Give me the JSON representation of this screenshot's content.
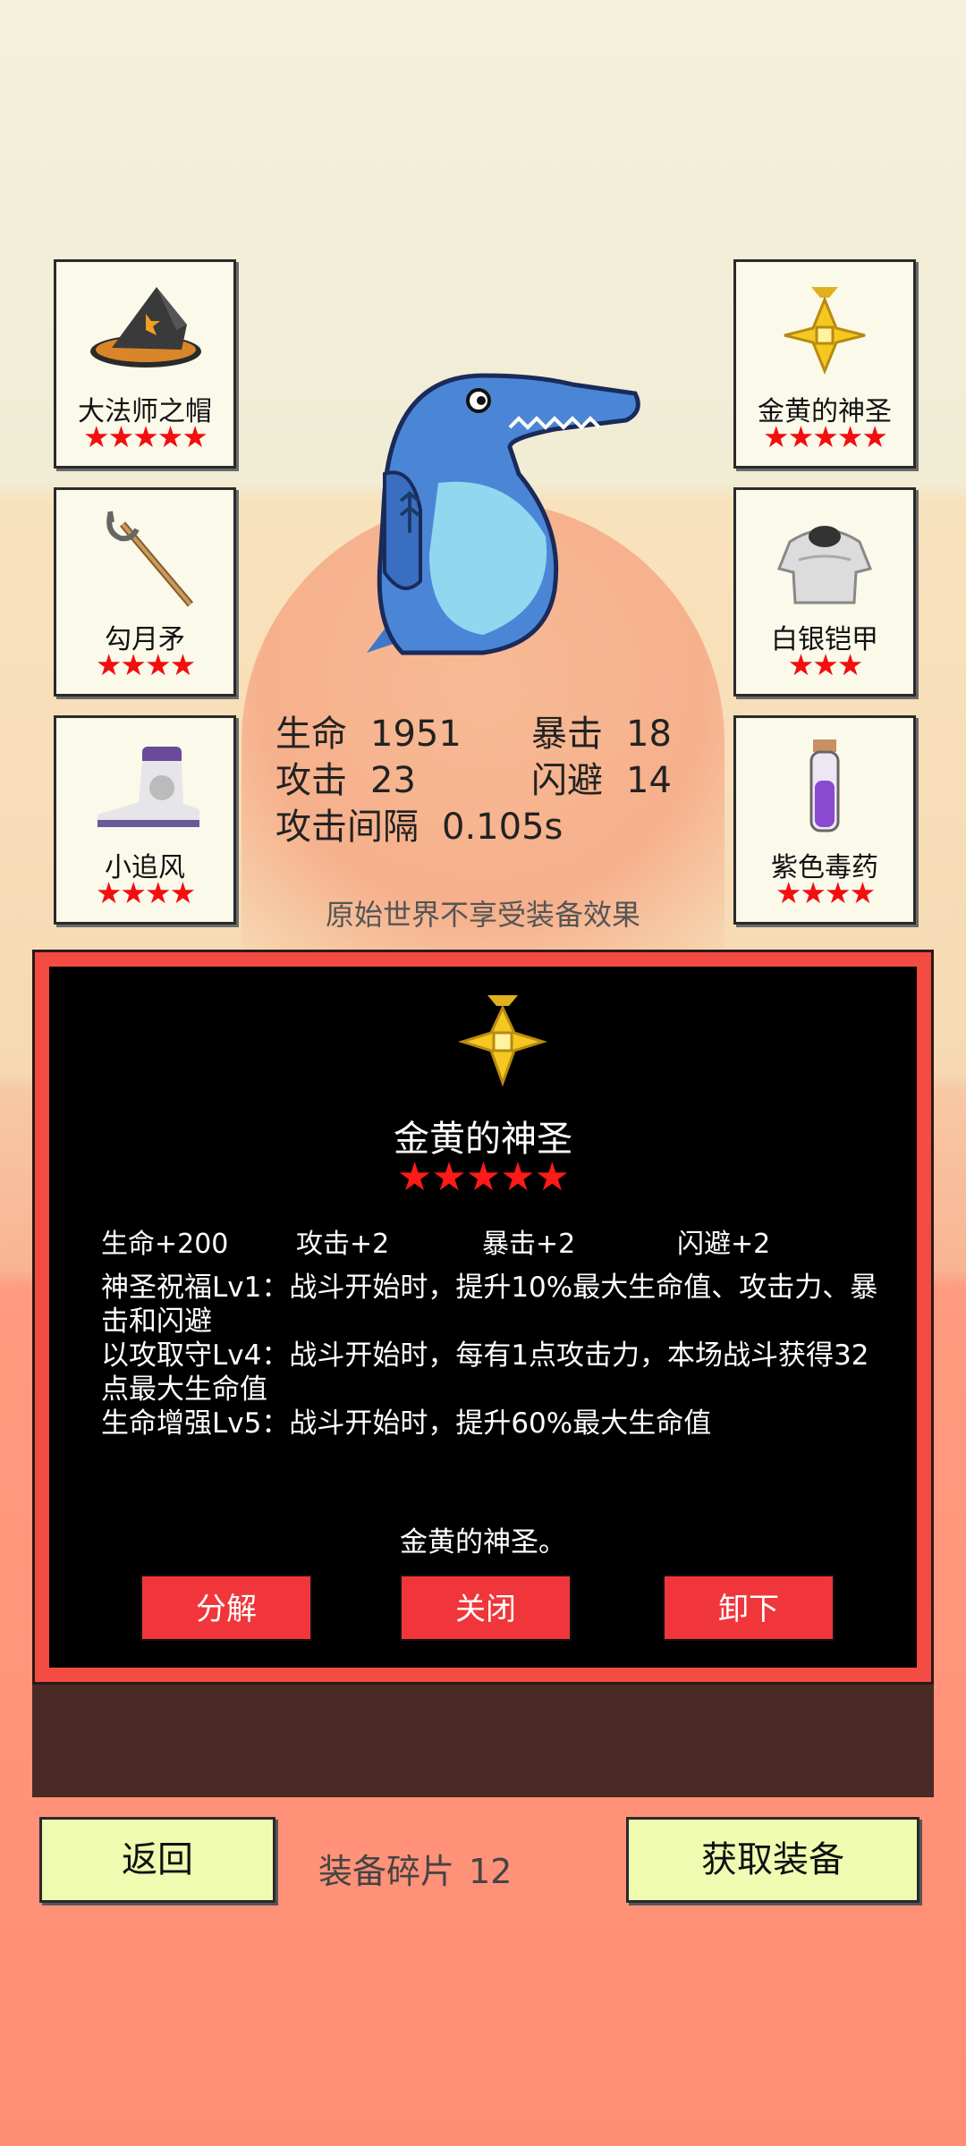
{
  "equipment_left": [
    {
      "name": "大法师之帽",
      "stars": "★★★★★",
      "icon": "wizard-hat-icon"
    },
    {
      "name": "勾月矛",
      "stars": "★★★★",
      "icon": "trident-icon"
    },
    {
      "name": "小追风",
      "stars": "★★★★",
      "icon": "boot-icon"
    }
  ],
  "equipment_right": [
    {
      "name": "金黄的神圣",
      "stars": "★★★★★",
      "icon": "gold-holy-cross-icon"
    },
    {
      "name": "白银铠甲",
      "stars": "★★★",
      "icon": "silver-armor-icon"
    },
    {
      "name": "紫色毒药",
      "stars": "★★★★",
      "icon": "purple-potion-icon"
    }
  ],
  "character": {
    "icon": "blue-crocodile-icon"
  },
  "stats": {
    "hp_label": "生命",
    "hp_value": "1951",
    "crit_label": "暴击",
    "crit_value": "18",
    "atk_label": "攻击",
    "atk_value": "23",
    "dodge_label": "闪避",
    "dodge_value": "14",
    "interval_label": "攻击间隔",
    "interval_value": "0.105s"
  },
  "note": "原始世界不享受装备效果",
  "detail": {
    "title": "金黄的神圣",
    "stars": "★★★★★",
    "attrs": [
      "生命+200",
      "攻击+2",
      "暴击+2",
      "闪避+2"
    ],
    "skills": [
      "神圣祝福Lv1：战斗开始时，提升10%最大生命值、攻击力、暴击和闪避",
      "以攻取守Lv4：战斗开始时，每有1点攻击力，本场战斗获得32点最大生命值",
      "生命增强Lv5：战斗开始时，提升60%最大生命值"
    ],
    "flavor": "金黄的神圣。",
    "btn_decompose": "分解",
    "btn_close": "关闭",
    "btn_unequip": "卸下"
  },
  "bottom": {
    "back": "返回",
    "fragments_label": "装备碎片",
    "fragments_count": "12",
    "get_equipment": "获取装备"
  },
  "colors": {
    "star": "#f10f0f",
    "panel_border": "#f34b42",
    "button_red": "#f0363a",
    "button_light": "#eefbb1"
  }
}
